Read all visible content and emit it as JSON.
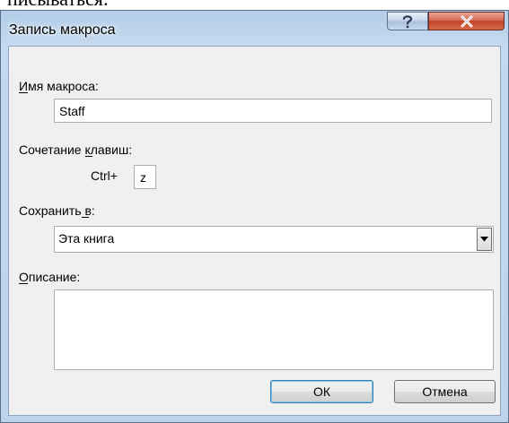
{
  "page_fragment_text": "писываться:",
  "window": {
    "title": "Запись макроса",
    "help_label": "?",
    "close_label": "X"
  },
  "form": {
    "name_label": "Имя макроса:",
    "name_value": "Staff",
    "shortcut_label": "Сочетание клавиш:",
    "shortcut_prefix": "Ctrl+",
    "shortcut_value": "z",
    "store_label": "Сохранить в:",
    "store_selected": "Эта книга",
    "description_label": "Описание:",
    "description_value": ""
  },
  "buttons": {
    "ok_label": "ОК",
    "cancel_label": "Отмена"
  },
  "icons": {
    "help": "question-mark-icon",
    "close": "close-x-icon",
    "dropdown": "chevron-down-icon"
  },
  "colors": {
    "title_bar": "#b3cde8",
    "close_button": "#c24227",
    "client_bg": "#f0f0f0",
    "default_button_border": "#3c7fb1"
  }
}
